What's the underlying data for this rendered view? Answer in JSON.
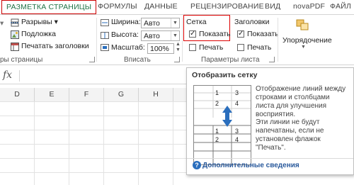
{
  "tabs": [
    "РАЗМЕТКА СТРАНИЦЫ",
    "ФОРМУЛЫ",
    "ДАННЫЕ",
    "РЕЦЕНЗИРОВАНИЕ",
    "ВИД",
    "novaPDF",
    "ФАЙЛ"
  ],
  "page_setup": {
    "breaks": "Разрывы",
    "background": "Подложка",
    "print_titles": "Печатать заголовки",
    "group_label": "ры страницы"
  },
  "scale_to_fit": {
    "width_label": "Ширина:",
    "width_value": "Авто",
    "height_label": "Высота:",
    "height_value": "Авто",
    "scale_label": "Масштаб:",
    "scale_value": "100%",
    "group_label": "Вписать"
  },
  "sheet_options": {
    "gridlines_title": "Сетка",
    "gridlines_view": "Показать",
    "gridlines_view_checked": true,
    "gridlines_print": "Печать",
    "headings_title": "Заголовки",
    "headings_view": "Показать",
    "headings_view_checked": true,
    "headings_print": "Печать",
    "group_label": "Параметры листа"
  },
  "arrange": {
    "label": "Упорядочение"
  },
  "formula_bar": {
    "fx": "fx",
    "value": ""
  },
  "columns": [
    "D",
    "E",
    "F",
    "G",
    "H"
  ],
  "tooltip": {
    "title": "Отобразить сетку",
    "preview_top": [
      "1",
      "3",
      "2",
      "4"
    ],
    "preview_bottom": [
      "1",
      "3",
      "2",
      "4"
    ],
    "description1": "Отображение линий между строками и столбцами листа для улучшения восприятия.",
    "description2": "Эти линии не будут напечатаны, если не установлен флажок \"Печать\".",
    "help_link": "Дополнительные сведения"
  }
}
